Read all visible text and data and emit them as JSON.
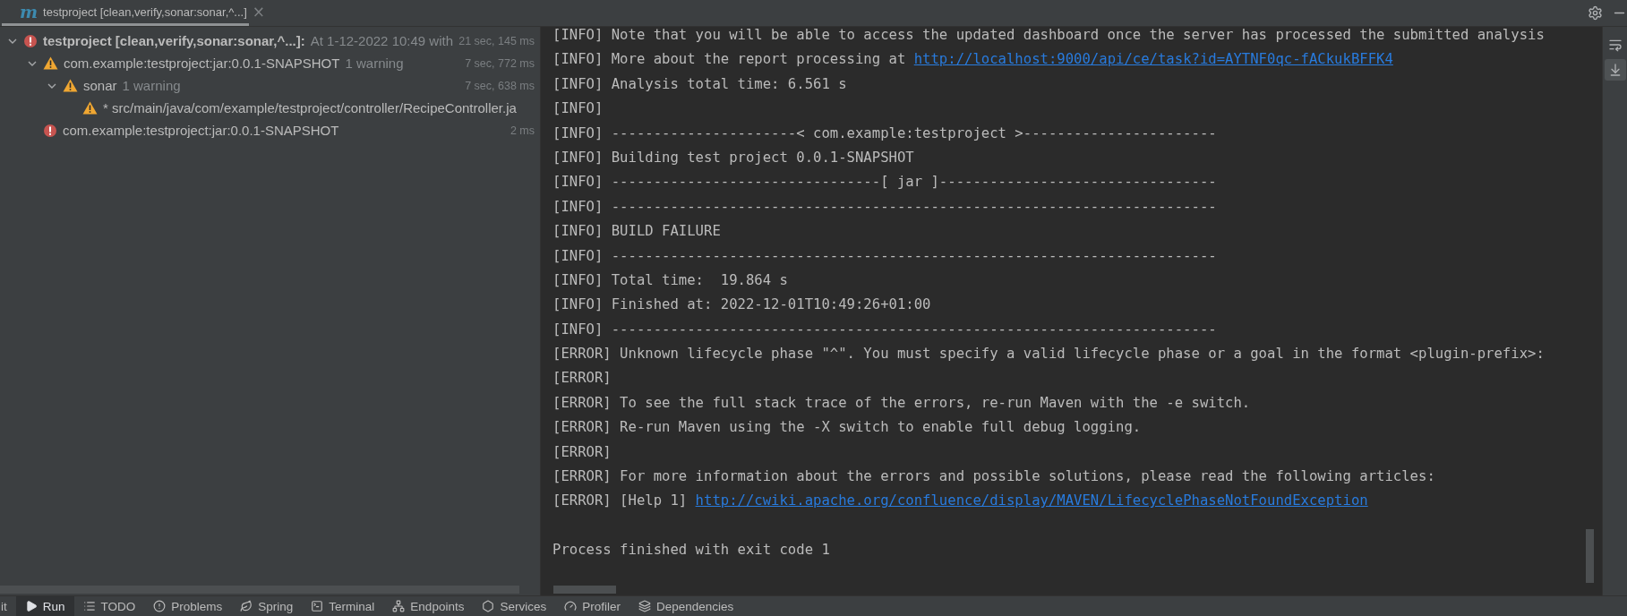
{
  "run_tab": {
    "logo": "m",
    "title": "testproject [clean,verify,sonar:sonar,^...]",
    "close": "×"
  },
  "tree": [
    {
      "kind": "error",
      "expanded": true,
      "label": "testproject [clean,verify,sonar:sonar,^...]:",
      "detail": "At 1-12-2022 10:49 with",
      "time": "21 sec, 145 ms",
      "children": [
        {
          "kind": "warning",
          "expanded": true,
          "label": "com.example:testproject:jar:0.0.1-SNAPSHOT",
          "detail": "1 warning",
          "time": "7 sec, 772 ms",
          "children": [
            {
              "kind": "warning",
              "expanded": true,
              "label": "sonar",
              "detail": "1 warning",
              "time": "7 sec, 638 ms",
              "children": [
                {
                  "kind": "warning",
                  "label": "* src/main/java/com/example/testproject/controller/RecipeController.ja"
                }
              ]
            }
          ]
        },
        {
          "kind": "error",
          "label": "com.example:testproject:jar:0.0.1-SNAPSHOT",
          "time": "2 ms"
        }
      ]
    }
  ],
  "console": {
    "lines": [
      {
        "text": "[INFO] Note that you will be able to access the updated dashboard once the server has processed the submitted analysis"
      },
      {
        "text": "[INFO] More about the report processing at ",
        "link": "http://localhost:9000/api/ce/task?id=AYTNF0qc-fACkukBFFK4"
      },
      {
        "text": "[INFO] Analysis total time: 6.561 s"
      },
      {
        "text": "[INFO]"
      },
      {
        "text": "[INFO] ----------------------< com.example:testproject >-----------------------"
      },
      {
        "text": "[INFO] Building test project 0.0.1-SNAPSHOT"
      },
      {
        "text": "[INFO] --------------------------------[ jar ]---------------------------------"
      },
      {
        "text": "[INFO] ------------------------------------------------------------------------"
      },
      {
        "text": "[INFO] BUILD FAILURE"
      },
      {
        "text": "[INFO] ------------------------------------------------------------------------"
      },
      {
        "text": "[INFO] Total time:  19.864 s"
      },
      {
        "text": "[INFO] Finished at: 2022-12-01T10:49:26+01:00"
      },
      {
        "text": "[INFO] ------------------------------------------------------------------------"
      },
      {
        "text": "[ERROR] Unknown lifecycle phase \"^\". You must specify a valid lifecycle phase or a goal in the format <plugin-prefix>:"
      },
      {
        "text": "[ERROR]"
      },
      {
        "text": "[ERROR] To see the full stack trace of the errors, re-run Maven with the -e switch."
      },
      {
        "text": "[ERROR] Re-run Maven using the -X switch to enable full debug logging."
      },
      {
        "text": "[ERROR]"
      },
      {
        "text": "[ERROR] For more information about the errors and possible solutions, please read the following articles:"
      },
      {
        "text": "[ERROR] [Help 1] ",
        "link": "http://cwiki.apache.org/confluence/display/MAVEN/LifecyclePhaseNotFoundException"
      }
    ],
    "exit_message": "Process finished with exit code 1"
  },
  "side_tools": [
    {
      "kind": "wrap",
      "selected": false
    },
    {
      "kind": "scroll-end",
      "selected": true
    }
  ],
  "bottom_tabs": [
    {
      "kind": "git",
      "label": "it",
      "selected": false
    },
    {
      "kind": "run",
      "label": "Run",
      "selected": true
    },
    {
      "kind": "todo",
      "label": "TODO",
      "selected": false
    },
    {
      "kind": "problems",
      "label": "Problems",
      "selected": false
    },
    {
      "kind": "spring",
      "label": "Spring",
      "selected": false
    },
    {
      "kind": "terminal",
      "label": "Terminal",
      "selected": false
    },
    {
      "kind": "endpoints",
      "label": "Endpoints",
      "selected": false
    },
    {
      "kind": "services",
      "label": "Services",
      "selected": false
    },
    {
      "kind": "profiler",
      "label": "Profiler",
      "selected": false
    },
    {
      "kind": "dependencies",
      "label": "Dependencies",
      "selected": false
    }
  ]
}
